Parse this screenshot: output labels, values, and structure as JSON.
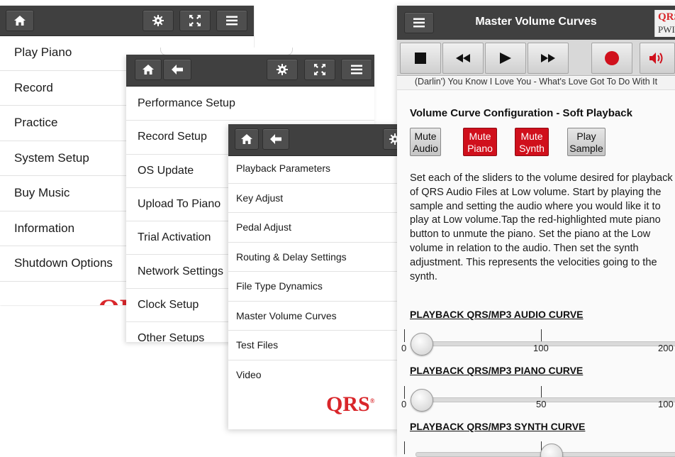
{
  "panel1": {
    "menu": [
      "Play Piano",
      "Record",
      "Practice",
      "System Setup",
      "Buy Music",
      "Information",
      "Shutdown Options"
    ],
    "icons": [
      "home-icon",
      "gear-icon",
      "fullscreen-icon",
      "hamburger-icon"
    ]
  },
  "panel2": {
    "menu": [
      "Performance Setup",
      "Record Setup",
      "OS Update",
      "Upload To Piano",
      "Trial Activation",
      "Network Settings",
      "Clock Setup",
      "Other Setups"
    ],
    "icons": [
      "home-icon",
      "back-arrow-icon",
      "gear-icon",
      "fullscreen-icon",
      "hamburger-icon"
    ]
  },
  "panel3": {
    "menu": [
      "Playback Parameters",
      "Key Adjust",
      "Pedal Adjust",
      "Routing & Delay Settings",
      "File Type Dynamics",
      "Master Volume Curves",
      "Test Files",
      "Video"
    ],
    "logo": "QRS",
    "icons": [
      "home-icon",
      "back-arrow-icon",
      "gear-icon"
    ]
  },
  "panel4": {
    "title": "Master Volume Curves",
    "badge_top": "QRS",
    "badge_bottom": "PWI",
    "transport_icons": [
      "stop-icon",
      "rewind-icon",
      "play-icon",
      "fast-forward-icon",
      "record-icon",
      "volume-icon"
    ],
    "song": "(Darlin') You Know I Love You - What's Love Got To Do With It",
    "config_title": "Volume Curve Configuration - Soft Playback",
    "buttons": [
      {
        "line1": "Mute",
        "line2": "Audio",
        "state": "off"
      },
      {
        "line1": "Mute",
        "line2": "Piano",
        "state": "on"
      },
      {
        "line1": "Mute",
        "line2": "Synth",
        "state": "on"
      },
      {
        "line1": "Play",
        "line2": "Sample",
        "state": "off"
      }
    ],
    "description": "Set each of the sliders to the volume desired for playback of QRS Audio Files at Low volume. Start by playing the sample and setting the audio where you would like it to play at Low volume.Tap the red-highlighted mute piano button to unmute the piano. Set the piano at the Low volume in relation to the audio. Then set the synth adjustment. This represents the velocities going to the synth.",
    "curves": [
      {
        "heading": "PLAYBACK QRS/MP3 AUDIO CURVE",
        "min": "0",
        "mid": "100",
        "max": "200",
        "value": 0
      },
      {
        "heading": "PLAYBACK QRS/MP3 PIANO CURVE",
        "min": "0",
        "mid": "50",
        "max": "100",
        "value": 0
      },
      {
        "heading": "PLAYBACK QRS/MP3 SYNTH CURVE",
        "value": 0.5
      }
    ]
  },
  "colors": {
    "toolbar": "#404040",
    "accent_red": "#d0101c",
    "logo_red": "#d9262a"
  }
}
